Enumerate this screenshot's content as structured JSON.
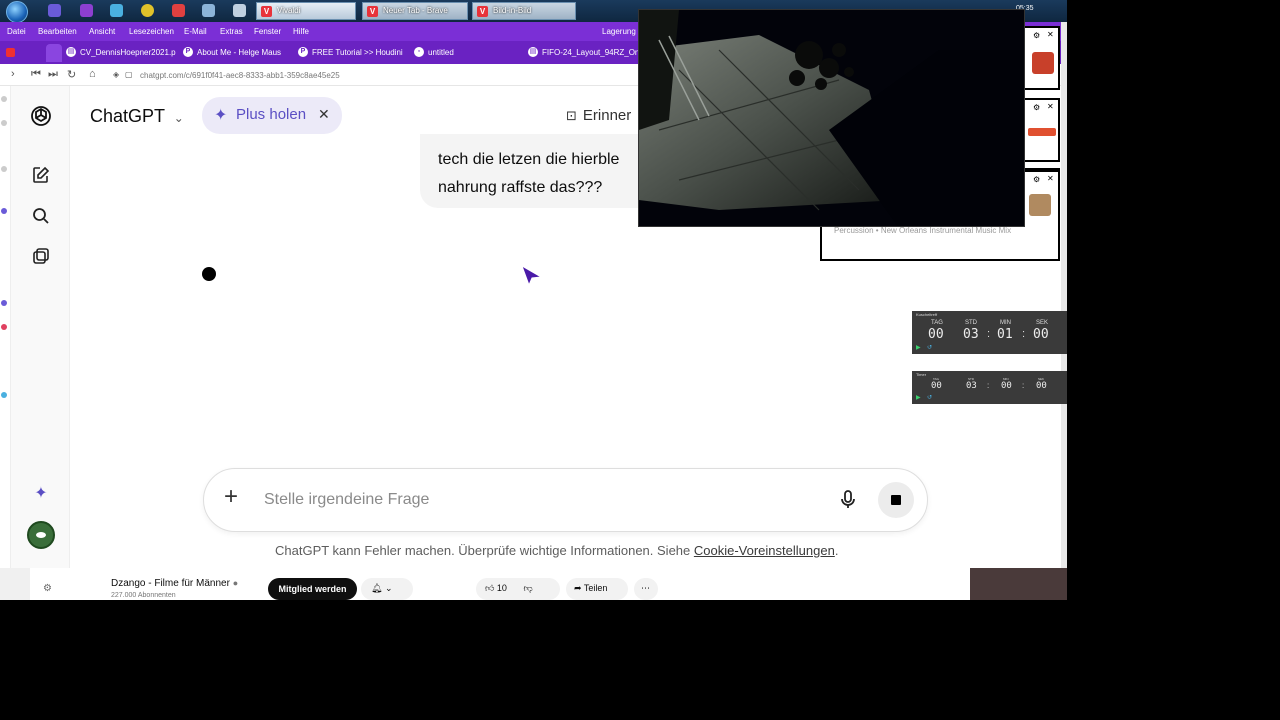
{
  "taskbar": {
    "tasks": [
      {
        "label": "Vivaldi"
      },
      {
        "label": "Neuer Tab - Brave"
      },
      {
        "label": "Bild-in-Bild"
      }
    ],
    "clock": "05:35"
  },
  "menubar": {
    "items": [
      "Datei",
      "Bearbeiten",
      "Ansicht",
      "Lesezeichen",
      "E-Mail",
      "Extras",
      "Fenster",
      "Hilfe"
    ],
    "right_label": "Lagerung"
  },
  "tabs": [
    {
      "label": "CV_DennisHoepner2021.p"
    },
    {
      "label": "About Me - Helge Maus"
    },
    {
      "label": "FREE Tutorial >> Houdini"
    },
    {
      "label": "untitled"
    },
    {
      "label": "FIFO-24_Layout_94RZ_On"
    }
  ],
  "address": {
    "url": "chatgpt.com/c/691f0f41-aec8-8333-abb1-359c8ae45e25"
  },
  "chat": {
    "model_title": "ChatGPT",
    "plus_label": "Plus holen",
    "erinner_label": "Erinner",
    "user_message_line1": "tech die letzen die hierble",
    "user_message_line2": "nahrung raffste das???",
    "composer_placeholder": "Stelle irgendeine Frage",
    "disclaimer_text": "ChatGPT kann Fehler machen. Überprüfe wichtige Informationen. Siehe ",
    "disclaimer_link": "Cookie-Voreinstellungen",
    "disclaimer_end": "."
  },
  "youtube": {
    "channel": "Dzango - Filme für Männer",
    "subscribers": "227.000 Abonnenten",
    "join": "Mitglied werden",
    "likes": "10",
    "share": "Teilen"
  },
  "music_card": {
    "text": "Percussion • New Orleans Instrumental Music Mix"
  },
  "timers": [
    {
      "header": "Kuscheltreff",
      "labels": [
        "TAG",
        "STD",
        "MIN",
        "SEK"
      ],
      "values": [
        "00",
        "03",
        "01",
        "00"
      ]
    },
    {
      "header": "Timer",
      "labels": [
        "TAG",
        "STD",
        "MIN",
        "SEK"
      ],
      "values": [
        "00",
        "03",
        "00",
        "00"
      ]
    }
  ],
  "colors": {
    "vivaldi_purple": "#7b2fd6",
    "chatgpt_plus_accent": "#5b4fc4"
  }
}
